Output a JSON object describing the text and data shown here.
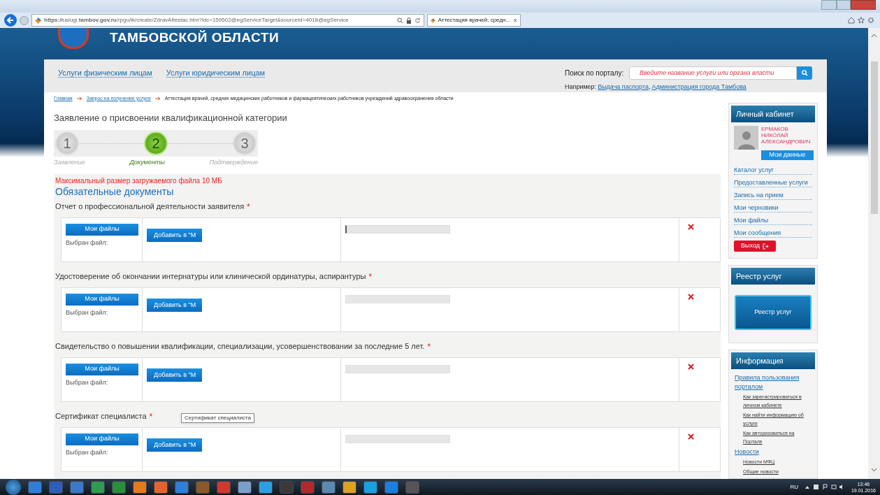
{
  "browser": {
    "url": "**https://**uslugi.**tambov.gov.ru**/rpgu/lk/create/ZdravAttestac.htm?idc=159502@egServiceTarget&sourceId=4018@egService",
    "tab_title": "Аттестация врачей, средн...",
    "tab_close": "×"
  },
  "header": {
    "region": "ТАМБОВСКОЙ ОБЛАСТИ"
  },
  "nav": {
    "links": [
      "Услуги физическим лицам",
      "Услуги юридическим лицам"
    ],
    "search_label": "Поиск по порталу:",
    "search_placeholder": "Введите название услуги или органа власти",
    "example_label": "Например:",
    "examples": [
      "Выдача паспорта",
      "Администрация города Тамбова"
    ],
    "example_separator": ","
  },
  "breadcrumb": [
    {
      "text": "Главная",
      "link": true
    },
    {
      "text": "Запрос на получение услуги",
      "link": true
    },
    {
      "text": "Аттестация врачей, средних медицинских работников и фармацевтических работников учреждений здравоохранения области",
      "link": false
    }
  ],
  "page_title": "Заявление о присвоении квалификационной категории",
  "steps": [
    {
      "number": "1",
      "label": "Заявление",
      "selected": false
    },
    {
      "number": "2",
      "label": "Документы",
      "selected": true
    },
    {
      "number": "3",
      "label": "Подтверждение",
      "selected": false
    }
  ],
  "notice": "Максимальный размер загружаемого файла 10 МБ",
  "section_title": "Обязательные документы",
  "documents": [
    {
      "label": "Отчет о профессиональной деятельности заявителя",
      "required_mark": "*",
      "my_files": "Мои файлы",
      "chosen": "Выбран файл:",
      "add": "Добавить в \"М",
      "focused": true
    },
    {
      "label": "Удостоверение об окончании интернатуры или клинической ординатуры, аспирантуры",
      "required_mark": "*",
      "my_files": "Мои файлы",
      "chosen": "Выбран файл:",
      "add": "Добавить в \"М",
      "focused": false
    },
    {
      "label": "Свидетельство о повышении квалификации, специализации, усовершенствовании за последние 5 лет.",
      "required_mark": "*",
      "my_files": "Мои файлы",
      "chosen": "Выбран файл:",
      "add": "Добавить в \"М",
      "focused": false
    },
    {
      "label": "Сертификат специалиста",
      "required_mark": "*",
      "my_files": "Мои файлы",
      "chosen": "Выбран файл:",
      "add": "Добавить в \"М",
      "focused": false,
      "tooltip": "Сертификат специалиста"
    }
  ],
  "sidebar": {
    "cabinet": {
      "title": "Личный кабинет",
      "name": [
        "ЕРМАКОВ",
        "НИКОЛАЙ",
        "АЛЕКСАНДРОВИЧ"
      ],
      "my_data": "Мои данные",
      "links": [
        "Каталог услуг",
        "Предоставленные услуги",
        "Запись на прием",
        "Мои черновики",
        "Мои файлы",
        "Мои сообщения"
      ],
      "logout": "Выход"
    },
    "registry": {
      "title": "Реестр услуг",
      "button": "Реестр услуг"
    },
    "info": {
      "title": "Информация",
      "items": [
        {
          "text": "Правила пользования порталом",
          "children": [
            {
              "text": "Как зарегистрироваться в личном кабинете"
            },
            {
              "text": "Как найти информацию об услуге"
            },
            {
              "text": "Как авторизоваться на Портале"
            }
          ]
        },
        {
          "text": "Новости",
          "children": [
            {
              "text": "Новости МФЦ"
            },
            {
              "text": "Общие новости"
            }
          ]
        }
      ]
    }
  },
  "taskbar": {
    "lang": "RU",
    "time": "13:46",
    "date": "19.01.2016"
  }
}
